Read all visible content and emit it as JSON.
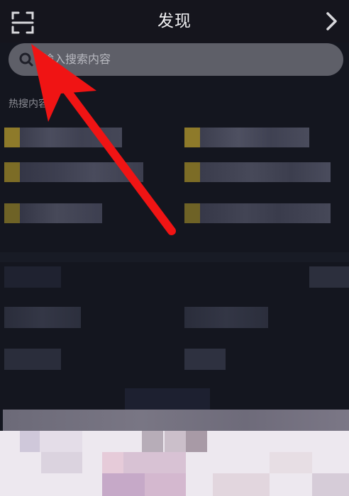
{
  "header": {
    "title": "发现",
    "scan_icon": "scan-icon",
    "next_icon": "chevron-right-icon"
  },
  "search": {
    "icon": "search-icon",
    "placeholder": "输入搜索内容"
  },
  "hot": {
    "label": "热搜内容"
  },
  "colors": {
    "background": "#14161f",
    "search_bg": "#5e5f68",
    "rank_highlight": "#8e7a2a",
    "annotation_arrow": "#f01414"
  },
  "annotation": {
    "type": "red-arrow",
    "points_to": "scan-icon"
  }
}
